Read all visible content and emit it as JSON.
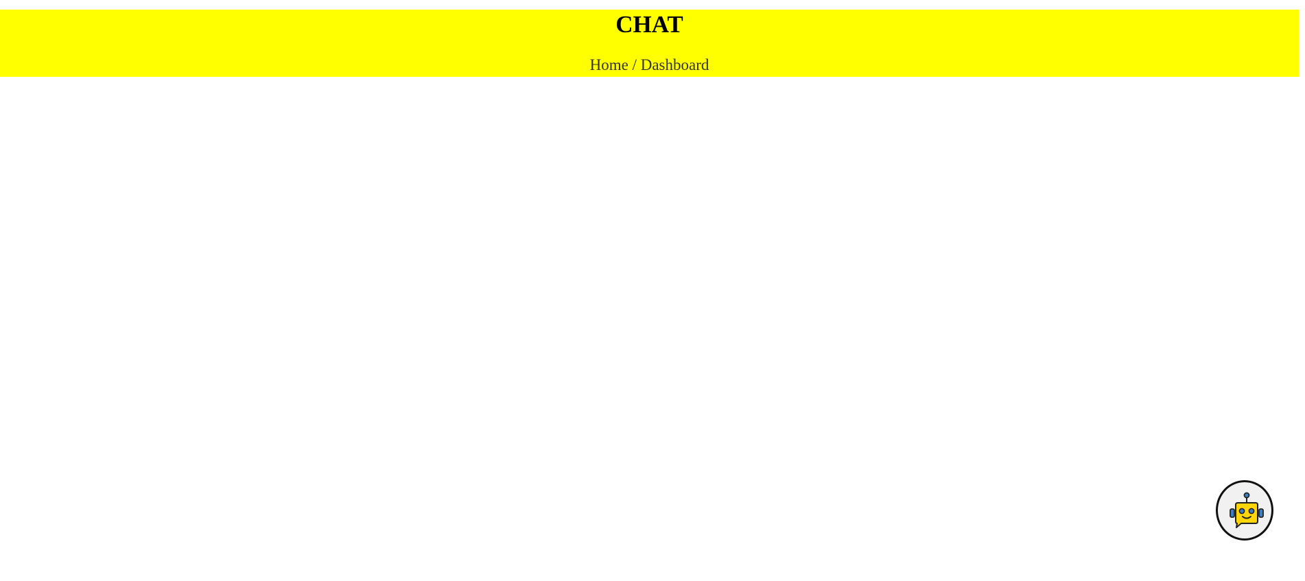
{
  "header": {
    "title": "CHAT",
    "breadcrumb": {
      "home": "Home",
      "separator": "/",
      "current": "Dashboard"
    },
    "background_color": "#ffff00"
  },
  "chatbot": {
    "icon": "robot-chat-icon",
    "face_color": "#ffd60a",
    "accent_color": "#3a7fc4"
  }
}
